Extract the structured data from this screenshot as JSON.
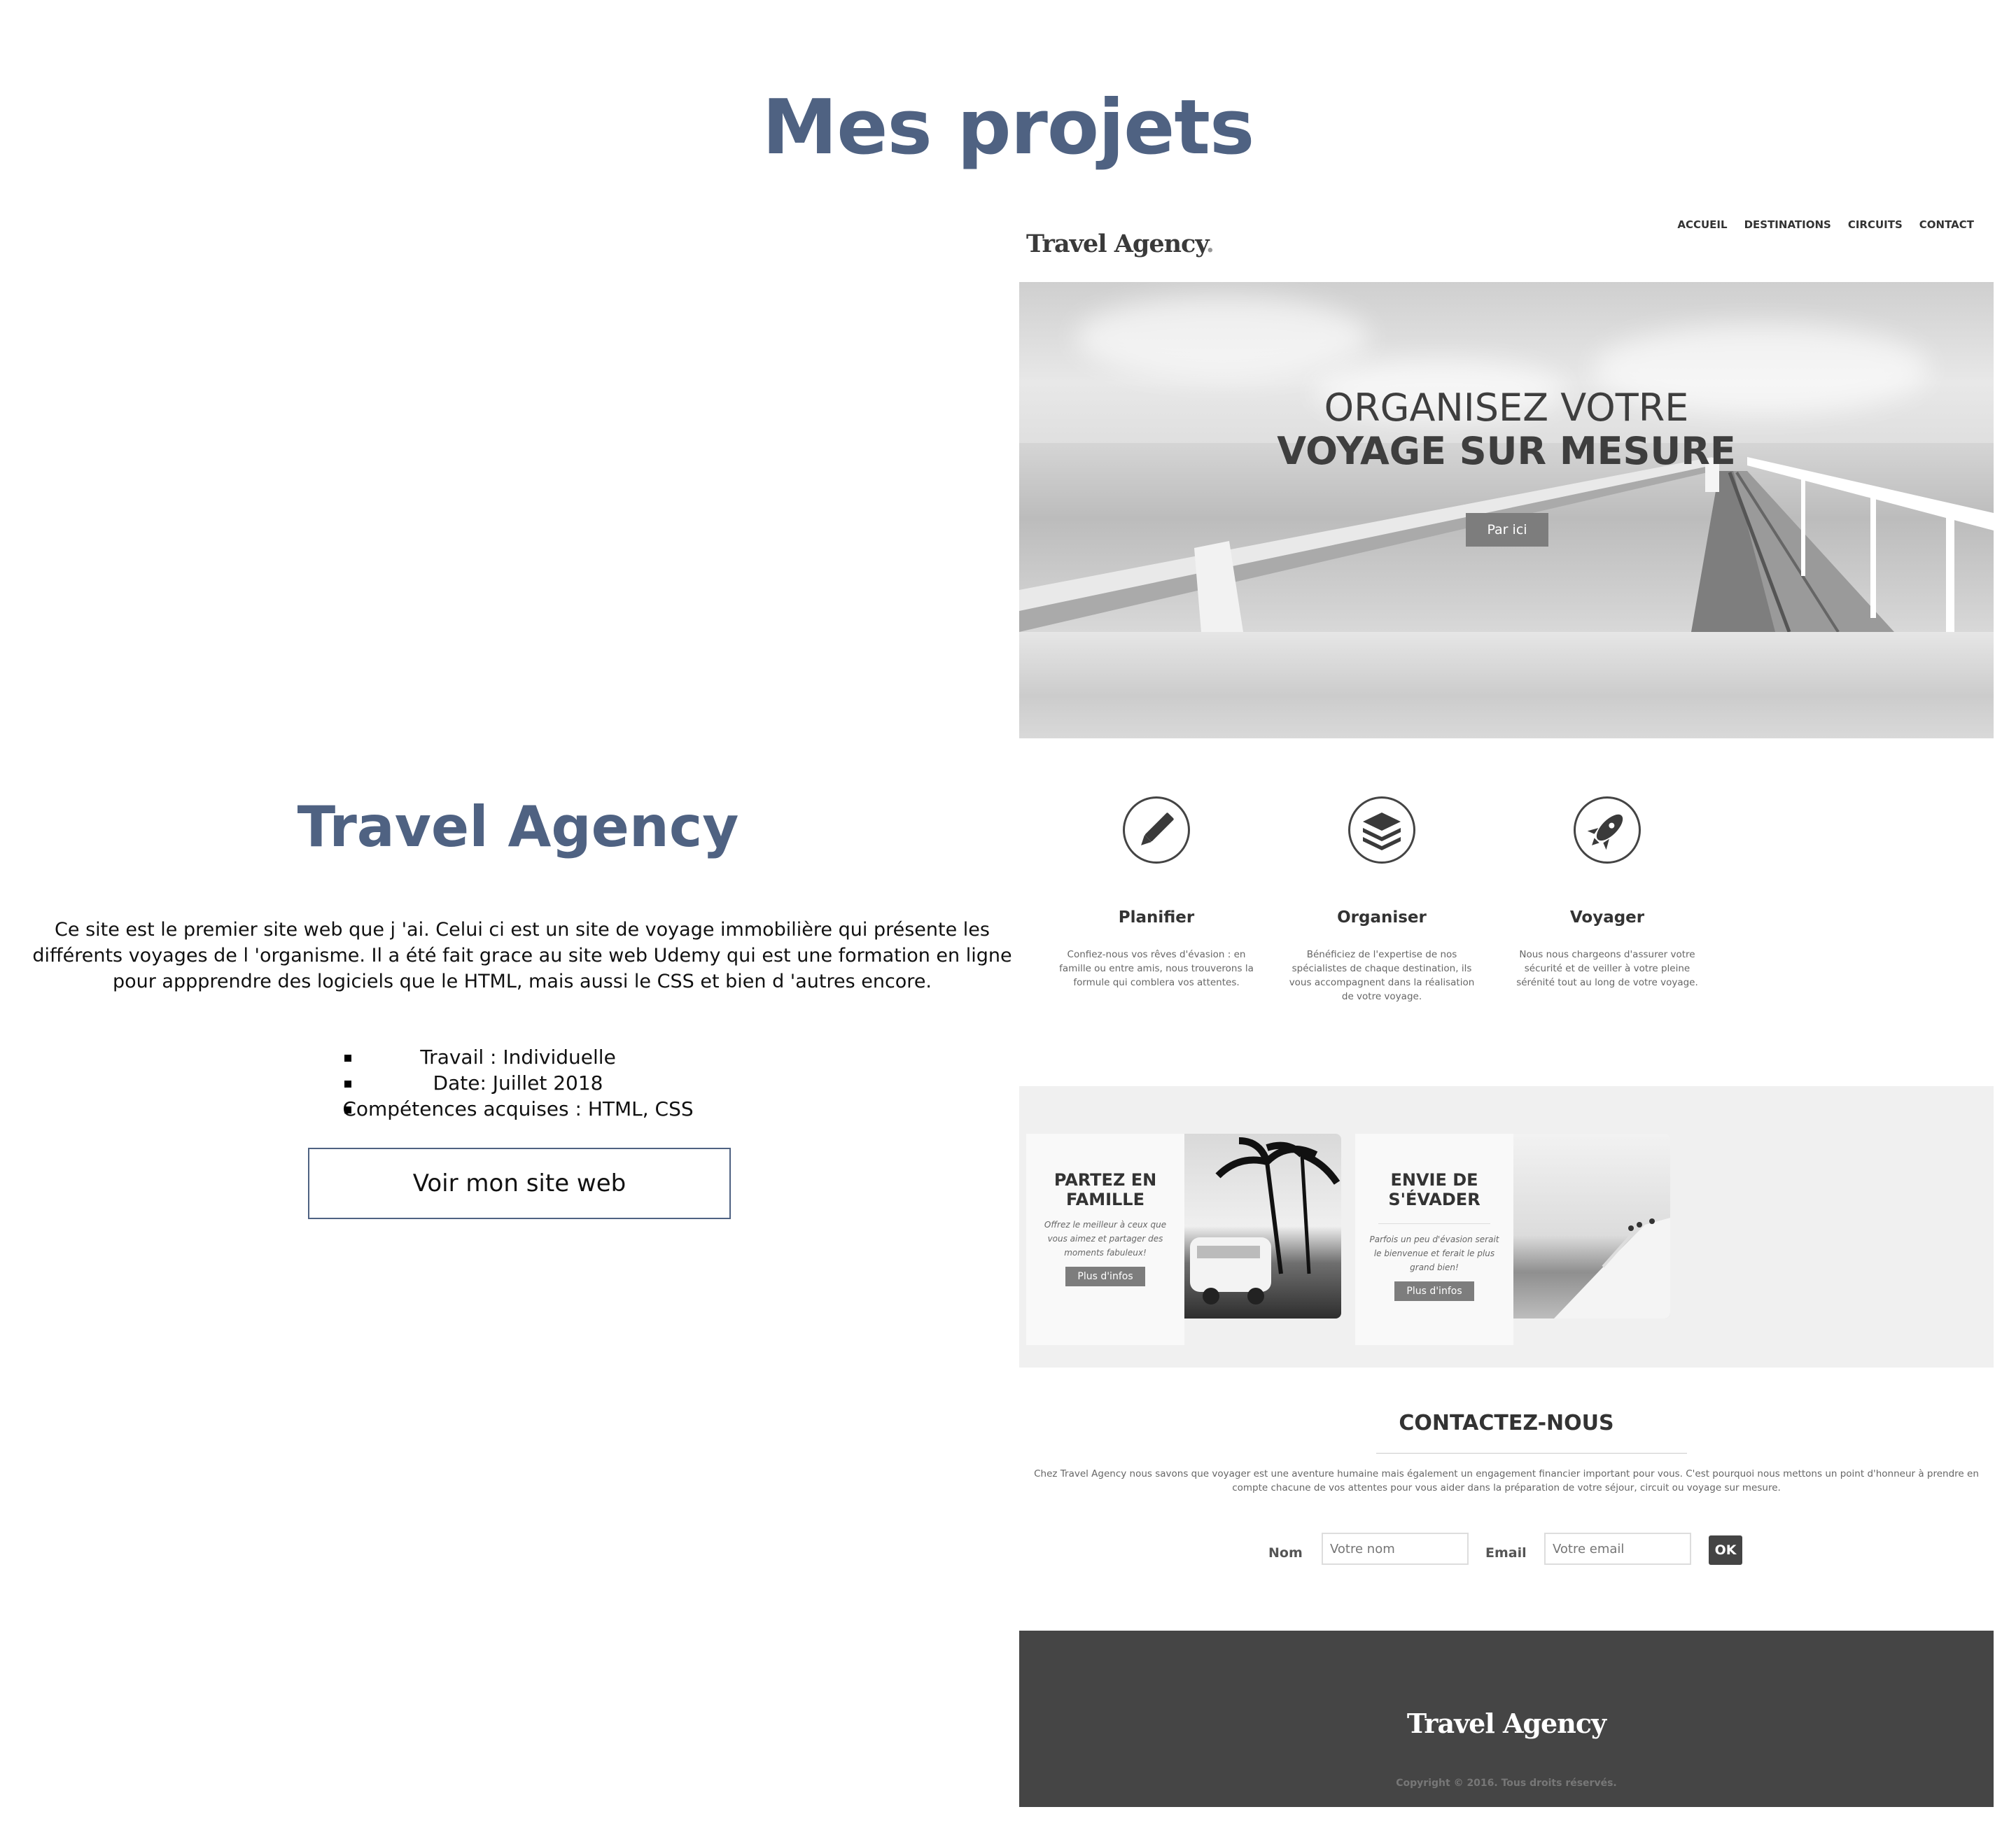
{
  "page": {
    "title": "Mes projets"
  },
  "project": {
    "title": "Travel Agency",
    "description": "Ce site est le premier site web que j 'ai. Celui ci est un site de voyage immobilière qui présente les différents voyages de l 'organisme. Il a été fait grace au site web Udemy qui est une formation en ligne pour appprendre des logiciels que le HTML, mais aussi le CSS et bien d 'autres encore.",
    "meta": [
      "Travail : Individuelle",
      "Date: Juillet 2018",
      "Compétences acquises : HTML, CSS"
    ],
    "button_label": "Voir mon site web"
  },
  "preview": {
    "logo": "Travel Agency",
    "logo_dot": ".",
    "nav": [
      "ACCUEIL",
      "DESTINATIONS",
      "CIRCUITS",
      "CONTACT"
    ],
    "hero": {
      "line1": "ORGANISEZ VOTRE",
      "line2": "VOYAGE SUR MESURE",
      "button": "Par ici"
    },
    "features": [
      {
        "icon": "pencil-icon",
        "title": "Planifier",
        "text": "Confiez-nous vos rêves d'évasion : en famille ou entre amis, nous trouverons la formule qui comblera vos attentes."
      },
      {
        "icon": "layers-icon",
        "title": "Organiser",
        "text": "Bénéficiez de l'expertise de nos spécialistes de chaque destination, ils vous accompagnent dans la réalisation de votre voyage."
      },
      {
        "icon": "rocket-icon",
        "title": "Voyager",
        "text": "Nous nous chargeons d'assurer votre sécurité et de veiller à votre pleine sérénité tout au long de votre voyage."
      }
    ],
    "cards": [
      {
        "title": "PARTEZ EN FAMILLE",
        "text": "Offrez le meilleur à ceux que vous aimez et partager des moments fabuleux!",
        "button": "Plus d'infos"
      },
      {
        "title": "ENVIE DE S'ÉVADER",
        "text": "Parfois un peu d'évasion serait le bienvenue et ferait le plus grand bien!",
        "button": "Plus d'infos"
      }
    ],
    "contact": {
      "title": "CONTACTEZ-NOUS",
      "text": "Chez Travel Agency nous savons que voyager est une aventure humaine mais également un engagement financier important pour vous. C'est pourquoi nous mettons un point d'honneur à prendre en compte chacune de vos attentes pour vous aider dans la préparation de votre séjour, circuit ou voyage sur mesure.",
      "name_label": "Nom",
      "name_placeholder": "Votre nom",
      "email_label": "Email",
      "email_placeholder": "Votre email",
      "submit": "OK"
    },
    "footer": {
      "logo": "Travel Agency",
      "copyright": "Copyright © 2016. Tous droits réservés."
    }
  },
  "colors": {
    "heading": "#4f6282",
    "footer_bg": "#454545",
    "button_gray": "#7d7d7d"
  }
}
